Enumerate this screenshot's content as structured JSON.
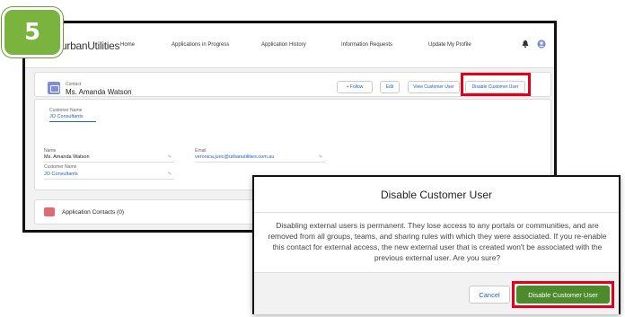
{
  "step": {
    "number": "5",
    "color": "#7ab33e"
  },
  "nav": {
    "logo": "urbanUtilities",
    "items": [
      "Home",
      "Applications in Progress",
      "Application History",
      "Information Requests",
      "Update My Profile"
    ],
    "icons": [
      "bell-icon",
      "user-icon"
    ]
  },
  "header": {
    "object_label": "Contact",
    "name": "Ms. Amanda Watson",
    "buttons": {
      "follow": "+ Follow",
      "edit": "Edit",
      "view_customer_user": "View Customer User",
      "disable_customer_user": "Disable Customer User"
    }
  },
  "details": {
    "customer_name_label": "Customer Name",
    "customer_name_value": "JO Consultants",
    "name_label": "Name",
    "name_value": "Ms. Amanda Watson",
    "email_label": "Email",
    "email_value": "veronica.juric@urbanutilities.com.au",
    "customer_name_label_2": "Customer Name",
    "customer_name_value_2": "JO Consultants"
  },
  "related": {
    "app_contacts": "Application Contacts (0)"
  },
  "modal": {
    "title": "Disable Customer User",
    "body": "Disabling external users is permanent. They lose access to any portals or communities, and are removed from all groups, teams, and sharing rules with which they were associated. If you re-enable this contact for external access, the new external user that is created won't be associated with the previous external user. Are you sure?",
    "cancel": "Cancel",
    "confirm": "Disable Customer User"
  },
  "colors": {
    "highlight": "#e3001b",
    "confirm_button": "#4c8a2c",
    "link": "#2262bf"
  }
}
